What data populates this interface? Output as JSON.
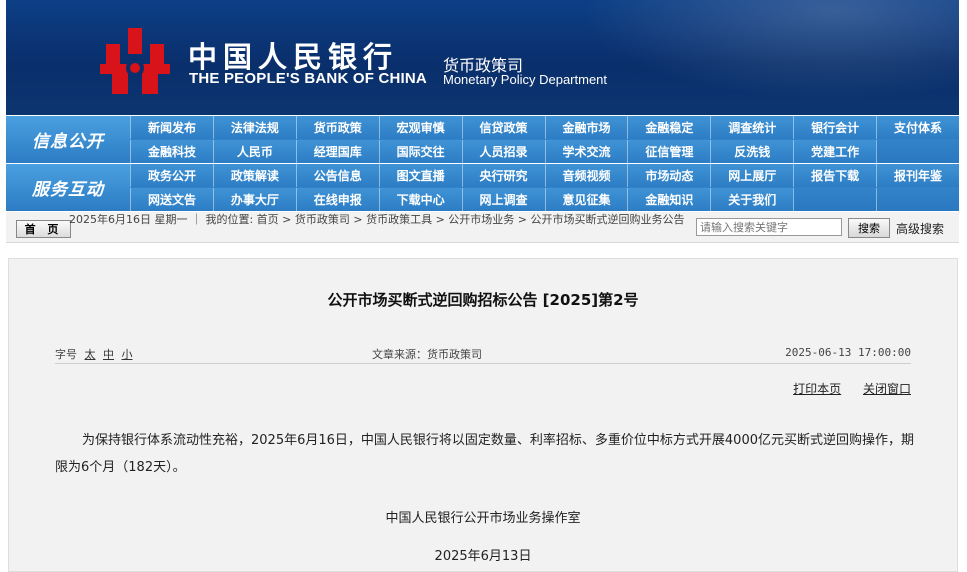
{
  "header": {
    "title_cn": "中国人民银行",
    "title_en": "THE PEOPLE'S BANK OF CHINA",
    "dept_cn": "货币政策司",
    "dept_en": "Monetary Policy Department",
    "emblem_color": "#d8131a"
  },
  "nav1": {
    "label": "信息公开",
    "items": [
      "新闻发布",
      "法律法规",
      "货币政策",
      "宏观审慎",
      "信贷政策",
      "金融市场",
      "金融稳定",
      "调查统计",
      "银行会计",
      "支付体系",
      "金融科技",
      "人民币",
      "经理国库",
      "国际交往",
      "人员招录",
      "学术交流",
      "征信管理",
      "反洗钱",
      "党建工作"
    ]
  },
  "nav2": {
    "label": "服务互动",
    "items": [
      "政务公开",
      "政策解读",
      "公告信息",
      "图文直播",
      "央行研究",
      "音频视频",
      "市场动态",
      "网上展厅",
      "报告下载",
      "报刊年鉴",
      "网送文告",
      "办事大厅",
      "在线申报",
      "下载中心",
      "网上调查",
      "意见征集",
      "金融知识",
      "关于我们"
    ]
  },
  "crumb": {
    "home": "首 页",
    "text": "2025年6月16日 星期一 ｜ 我的位置: 首页  >  货币政策司  >  货币政策工具  >  公开市场业务  >  公开市场买断式逆回购业务公告",
    "search_placeholder": "请输入搜索关键字",
    "search_btn": "搜索",
    "advanced": "高级搜索"
  },
  "article": {
    "title": "公开市场买断式逆回购招标公告 [2025]第2号",
    "font_label": "字号",
    "font_big": "太",
    "font_mid": "中",
    "font_small": "小",
    "source": "文章来源：货币政策司",
    "datetime": "2025-06-13 17:00:00",
    "print": "打印本页",
    "close": "关闭窗口",
    "body": "为保持银行体系流动性充裕，2025年6月16日，中国人民银行将以固定数量、利率招标、多重价位中标方式开展4000亿元买断式逆回购操作，期限为6个月（182天）。",
    "signature": "中国人民银行公开市场业务操作室",
    "date": "2025年6月13日"
  }
}
